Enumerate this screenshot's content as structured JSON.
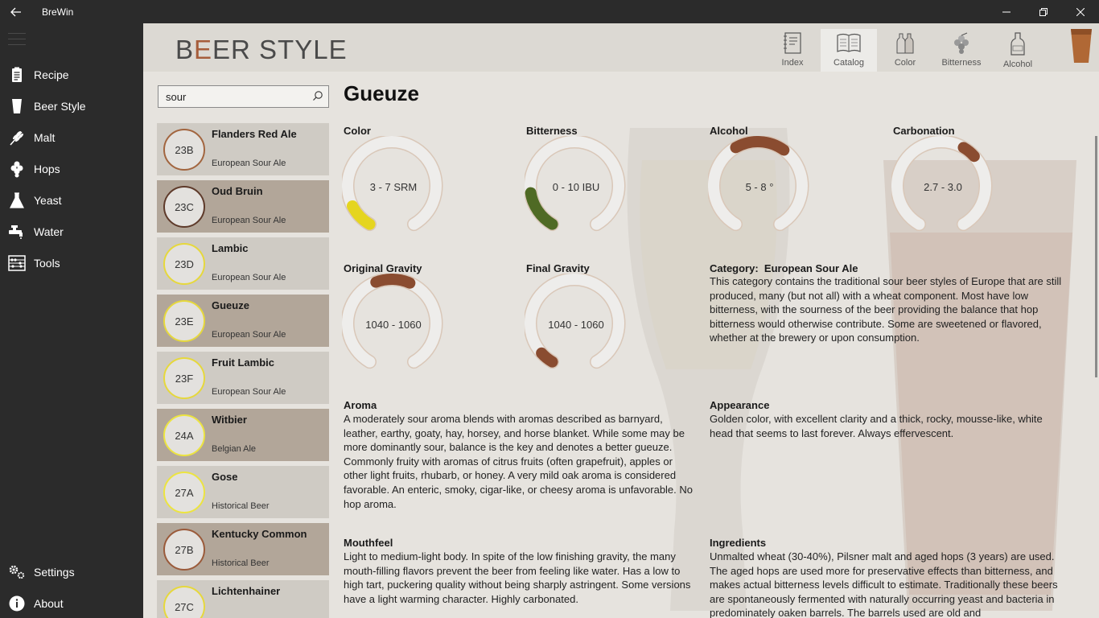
{
  "window": {
    "title": "BreWin"
  },
  "sidebar": {
    "items": [
      {
        "label": "Recipe",
        "icon": "clipboard-icon"
      },
      {
        "label": "Beer Style",
        "icon": "glass-icon"
      },
      {
        "label": "Malt",
        "icon": "wheat-icon"
      },
      {
        "label": "Hops",
        "icon": "hop-icon"
      },
      {
        "label": "Yeast",
        "icon": "flask-icon"
      },
      {
        "label": "Water",
        "icon": "faucet-icon"
      },
      {
        "label": "Tools",
        "icon": "abacus-icon"
      }
    ],
    "bottom": [
      {
        "label": "Settings",
        "icon": "gear-icon"
      },
      {
        "label": "About",
        "icon": "info-icon"
      }
    ]
  },
  "header": {
    "title_b": "B",
    "title_e": "E",
    "title_rest": "ER STYLE",
    "tabs": [
      "Index",
      "Catalog",
      "Color",
      "Bitterness",
      "Alcohol"
    ]
  },
  "search": {
    "value": "sour"
  },
  "styles": [
    {
      "code": "23B",
      "name": "Flanders Red Ale",
      "category": "European Sour Ale",
      "ring": "#a2653f"
    },
    {
      "code": "23C",
      "name": "Oud Bruin",
      "category": "European Sour Ale",
      "ring": "#5e3a2a"
    },
    {
      "code": "23D",
      "name": "Lambic",
      "category": "European Sour Ale",
      "ring": "#e6d83c"
    },
    {
      "code": "23E",
      "name": "Gueuze",
      "category": "European Sour Ale",
      "ring": "#e6d83c"
    },
    {
      "code": "23F",
      "name": "Fruit Lambic",
      "category": "European Sour Ale",
      "ring": "#e6d83c"
    },
    {
      "code": "24A",
      "name": "Witbier",
      "category": "Belgian Ale",
      "ring": "#ece440"
    },
    {
      "code": "27A",
      "name": "Gose",
      "category": "Historical Beer",
      "ring": "#ece440"
    },
    {
      "code": "27B",
      "name": "Kentucky Common",
      "category": "Historical Beer",
      "ring": "#9a5a3a"
    },
    {
      "code": "27C",
      "name": "Lichtenhainer",
      "category": "",
      "ring": "#e6d83c"
    }
  ],
  "detail": {
    "name": "Gueuze",
    "gauges": [
      {
        "label": "Color",
        "value": "3 - 7 SRM",
        "color": "#e5d51f",
        "from": 0.0,
        "to": 0.11
      },
      {
        "label": "Bitterness",
        "value": "0 - 10 IBU",
        "color": "#4f6a24",
        "from": 0.0,
        "to": 0.17
      },
      {
        "label": "Alcohol",
        "value": "5 - 8 °",
        "color": "#8a4c30",
        "from": 0.4,
        "to": 0.62
      },
      {
        "label": "Carbonation",
        "value": "2.7 - 3.0",
        "color": "#8a4c30",
        "from": 0.6,
        "to": 0.66
      },
      {
        "label": "Original Gravity",
        "value": "1040 - 1060",
        "color": "#8a4c30",
        "from": 0.43,
        "to": 0.58
      },
      {
        "label": "Final Gravity",
        "value": "1040 - 1060",
        "color": "#8a4c30",
        "from": 0.0,
        "to": 0.06
      }
    ],
    "category_label": "Category:",
    "category_value": "European Sour Ale",
    "category_text": "This category contains the traditional sour beer styles of Europe that are still produced, many (but not all) with a wheat component. Most have low bitterness, with the sourness of the beer providing the balance that hop bitterness would otherwise contribute. Some are sweetened or flavored, whether at the brewery or upon consumption.",
    "aroma_label": "Aroma",
    "aroma_text": "A moderately sour aroma blends with aromas described as barnyard, leather, earthy, goaty, hay, horsey, and horse blanket. While some may be more dominantly sour, balance is the key and denotes a better gueuze. Commonly fruity with aromas of citrus fruits (often grapefruit), apples or other light fruits, rhubarb, or honey. A very mild oak aroma is considered favorable. An enteric, smoky, cigar-like, or cheesy aroma is unfavorable. No hop aroma.",
    "appearance_label": "Appearance",
    "appearance_text": "Golden color, with excellent clarity and a thick, rocky, mousse-like, white head that seems to last forever. Always effervescent.",
    "mouthfeel_label": "Mouthfeel",
    "mouthfeel_text": "Light to medium-light body. In spite of the low finishing gravity, the many mouth-filling flavors prevent the beer from feeling like water. Has a low to high tart, puckering quality without being sharply astringent. Some versions have a light warming character. Highly carbonated.",
    "ingredients_label": "Ingredients",
    "ingredients_text": "Unmalted wheat (30-40%), Pilsner malt and aged hops (3 years) are used. The aged hops are used more for preservative effects than bitterness, and makes actual bitterness levels difficult to estimate. Traditionally these beers are spontaneously fermented with naturally occurring yeast and bacteria in predominately oaken barrels. The barrels used are old and"
  }
}
